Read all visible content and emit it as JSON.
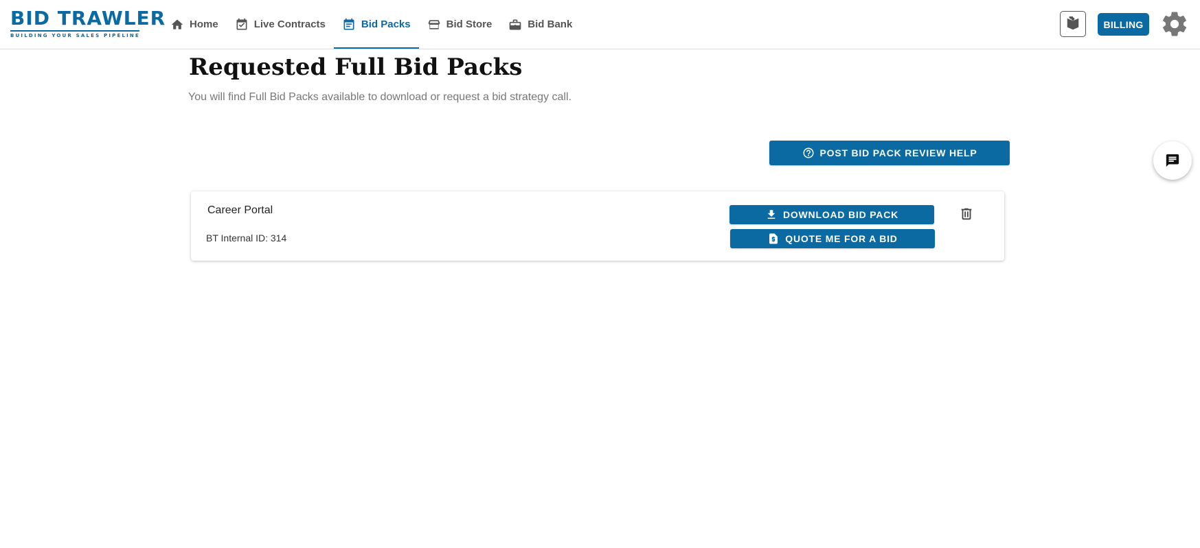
{
  "logo": {
    "title": "BID TRAWLER",
    "tagline": "BUILDING YOUR SALES PIPELINE"
  },
  "nav": {
    "items": [
      {
        "label": "Home",
        "icon": "home-icon",
        "active": false
      },
      {
        "label": "Live Contracts",
        "icon": "calendar-check-icon",
        "active": false
      },
      {
        "label": "Bid Packs",
        "icon": "calendar-list-icon",
        "active": true
      },
      {
        "label": "Bid Store",
        "icon": "store-icon",
        "active": false
      },
      {
        "label": "Bid Bank",
        "icon": "briefcase-icon",
        "active": false
      }
    ]
  },
  "header": {
    "billing_label": "BILLING",
    "tutorial_icon": "book-icon",
    "settings_icon": "gear-icon"
  },
  "main": {
    "title": "Requested Full Bid Packs",
    "subtitle": "You will find Full Bid Packs available to download or request a bid strategy call.",
    "help_button": "POST BID PACK REVIEW HELP"
  },
  "bid_packs": [
    {
      "name": "Career Portal",
      "internal_id": "BT Internal ID: 314",
      "download_label": "DOWNLOAD BID PACK",
      "quote_label": "QUOTE ME FOR A BID"
    }
  ],
  "colors": {
    "primary": "#0b6aa2",
    "text_muted": "#777777",
    "nav_text": "#555555"
  }
}
